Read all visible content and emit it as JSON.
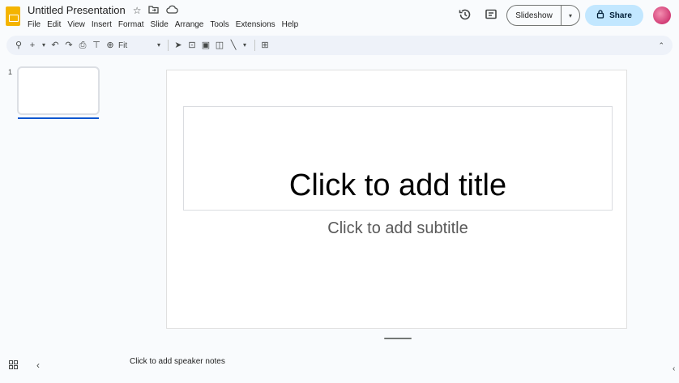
{
  "app": {
    "title": "Untitled Presentation",
    "icon": "slides-app-icon",
    "accent": "#f4b400"
  },
  "menu": [
    "File",
    "Edit",
    "View",
    "Insert",
    "Format",
    "Slide",
    "Arrange",
    "Tools",
    "Extensions",
    "Help"
  ],
  "header": {
    "slideshow_label": "Slideshow",
    "share_label": "Share",
    "share_color": "#c2e7ff"
  },
  "toolbar": {
    "zoom_value": "Fit"
  },
  "filmstrip": {
    "slide_number": "1",
    "selected_color": "#0b57d0"
  },
  "slide": {
    "title_placeholder": "Click to add title",
    "subtitle_placeholder": "Click to add subtitle"
  },
  "notes": {
    "placeholder": "Click to add speaker notes"
  }
}
